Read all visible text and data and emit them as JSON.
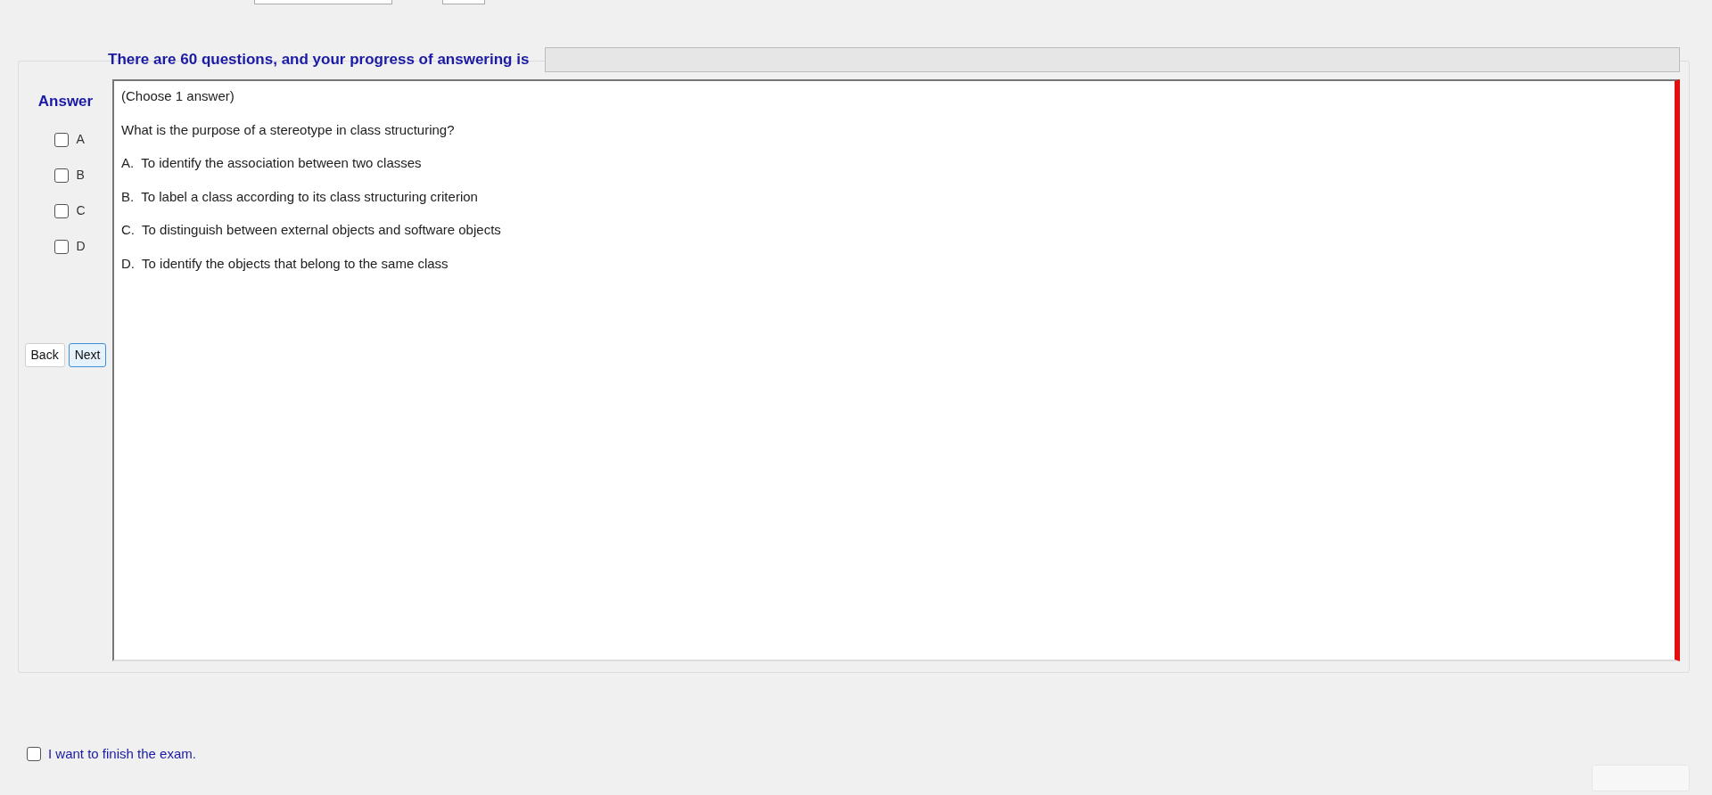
{
  "progress": {
    "label": "There are 60 questions, and your progress of answering is",
    "level": 0
  },
  "answer_panel": {
    "title": "Answer",
    "options": [
      {
        "label": "A",
        "checked": false
      },
      {
        "label": "B",
        "checked": false
      },
      {
        "label": "C",
        "checked": false
      },
      {
        "label": "D",
        "checked": false
      }
    ],
    "buttons": [
      {
        "label": "Back",
        "focused": false
      },
      {
        "label": "Next",
        "focused": true
      }
    ]
  },
  "question": {
    "instruction": "(Choose 1 answer)",
    "text": "What is the purpose of a stereotype in class structuring?",
    "choices": [
      "A.  To identify the association between two classes",
      "B.  To label a class according to its class structuring criterion",
      "C.  To distinguish between external objects and software objects",
      "D.  To identify the objects that belong to the same class"
    ]
  },
  "finish": {
    "label": "I want to finish the exam.",
    "checked": false
  }
}
